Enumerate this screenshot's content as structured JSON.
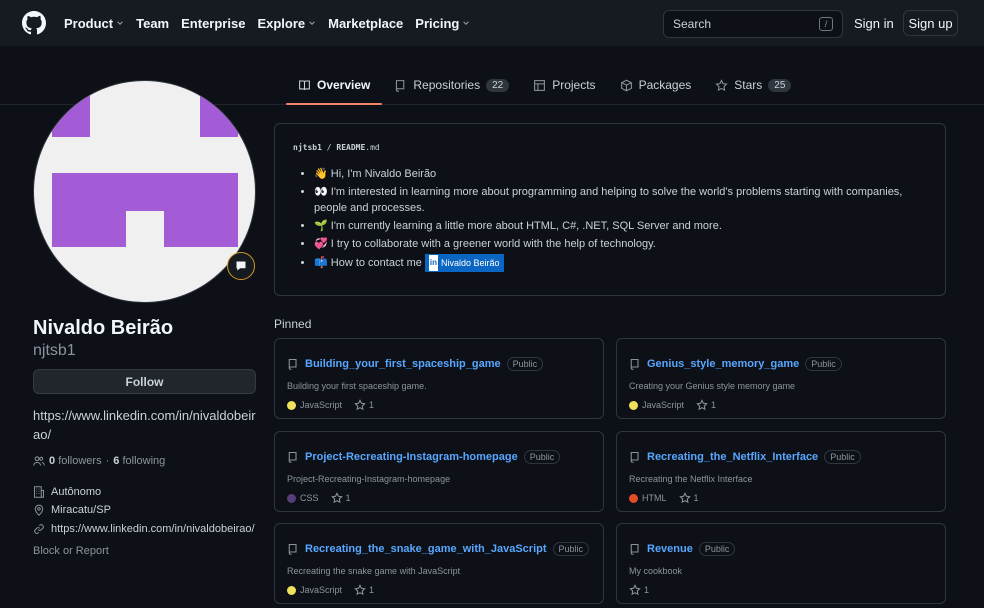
{
  "header": {
    "nav": [
      "Product",
      "Team",
      "Enterprise",
      "Explore",
      "Marketplace",
      "Pricing"
    ],
    "nav_dropdown": [
      true,
      false,
      false,
      true,
      false,
      true
    ],
    "search_placeholder": "Search",
    "search_key": "/",
    "sign_in": "Sign in",
    "sign_up": "Sign up"
  },
  "tabs": [
    {
      "label": "Overview",
      "count": "",
      "icon": "book-icon"
    },
    {
      "label": "Repositories",
      "count": "22",
      "icon": "repo-icon"
    },
    {
      "label": "Projects",
      "count": "",
      "icon": "table-icon"
    },
    {
      "label": "Packages",
      "count": "",
      "icon": "package-icon"
    },
    {
      "label": "Stars",
      "count": "25",
      "icon": "star-icon"
    }
  ],
  "profile": {
    "name": "Nivaldo Beirão",
    "username": "njtsb1",
    "follow": "Follow",
    "bio": "https://www.linkedin.com/in/nivaldobeirao/",
    "followers_count": "0",
    "followers_label": "followers",
    "sep": "·",
    "following_count": "6",
    "following_label": "following",
    "company": "Autônomo",
    "location": "Miracatu/SP",
    "website": "https://www.linkedin.com/in/nivaldobeirao/",
    "block": "Block or Report"
  },
  "readme": {
    "path_user": "njtsb1",
    "path_sep": "/",
    "path_file": "README",
    "path_ext": ".md",
    "items": [
      {
        "emoji": "👋",
        "text": "Hi, I'm Nivaldo Beirão"
      },
      {
        "emoji": "👀",
        "text": "I'm interested in learning more about programming and helping to solve the world's problems starting with companies, people and processes."
      },
      {
        "emoji": "🌱",
        "text": "I'm currently learning a little more about HTML, C#, .NET, SQL Server and more."
      },
      {
        "emoji": "💞️",
        "text": "I try to collaborate with a greener world with the help of technology."
      },
      {
        "emoji": "📫",
        "text": "How to contact me"
      }
    ],
    "badge": "Nivaldo Beirão"
  },
  "pinned_title": "Pinned",
  "pinned": [
    {
      "name": "Building_your_first_spaceship_game",
      "vis": "Public",
      "desc": "Building your first spaceship game.",
      "lang": "JavaScript",
      "color": "#f1e05a",
      "stars": "1"
    },
    {
      "name": "Genius_style_memory_game",
      "vis": "Public",
      "desc": "Creating your Genius style memory game",
      "lang": "JavaScript",
      "color": "#f1e05a",
      "stars": "1"
    },
    {
      "name": "Project-Recreating-Instagram-homepage",
      "vis": "Public",
      "desc": "Project-Recreating-Instagram-homepage",
      "lang": "CSS",
      "color": "#563d7c",
      "stars": "1"
    },
    {
      "name": "Recreating_the_Netflix_Interface",
      "vis": "Public",
      "desc": "Recreating the Netflix Interface",
      "lang": "HTML",
      "color": "#e34c26",
      "stars": "1"
    },
    {
      "name": "Recreating_the_snake_game_with_JavaScript",
      "vis": "Public",
      "desc": "Recreating the snake game with JavaScript",
      "lang": "JavaScript",
      "color": "#f1e05a",
      "stars": "1"
    },
    {
      "name": "Revenue",
      "vis": "Public",
      "desc": "My cookbook",
      "lang": "",
      "color": "",
      "stars": "1"
    }
  ],
  "colors": {
    "accent": "#58a6ff",
    "tab_underline": "#f78166",
    "avatar_purple": "#a35bd6"
  }
}
